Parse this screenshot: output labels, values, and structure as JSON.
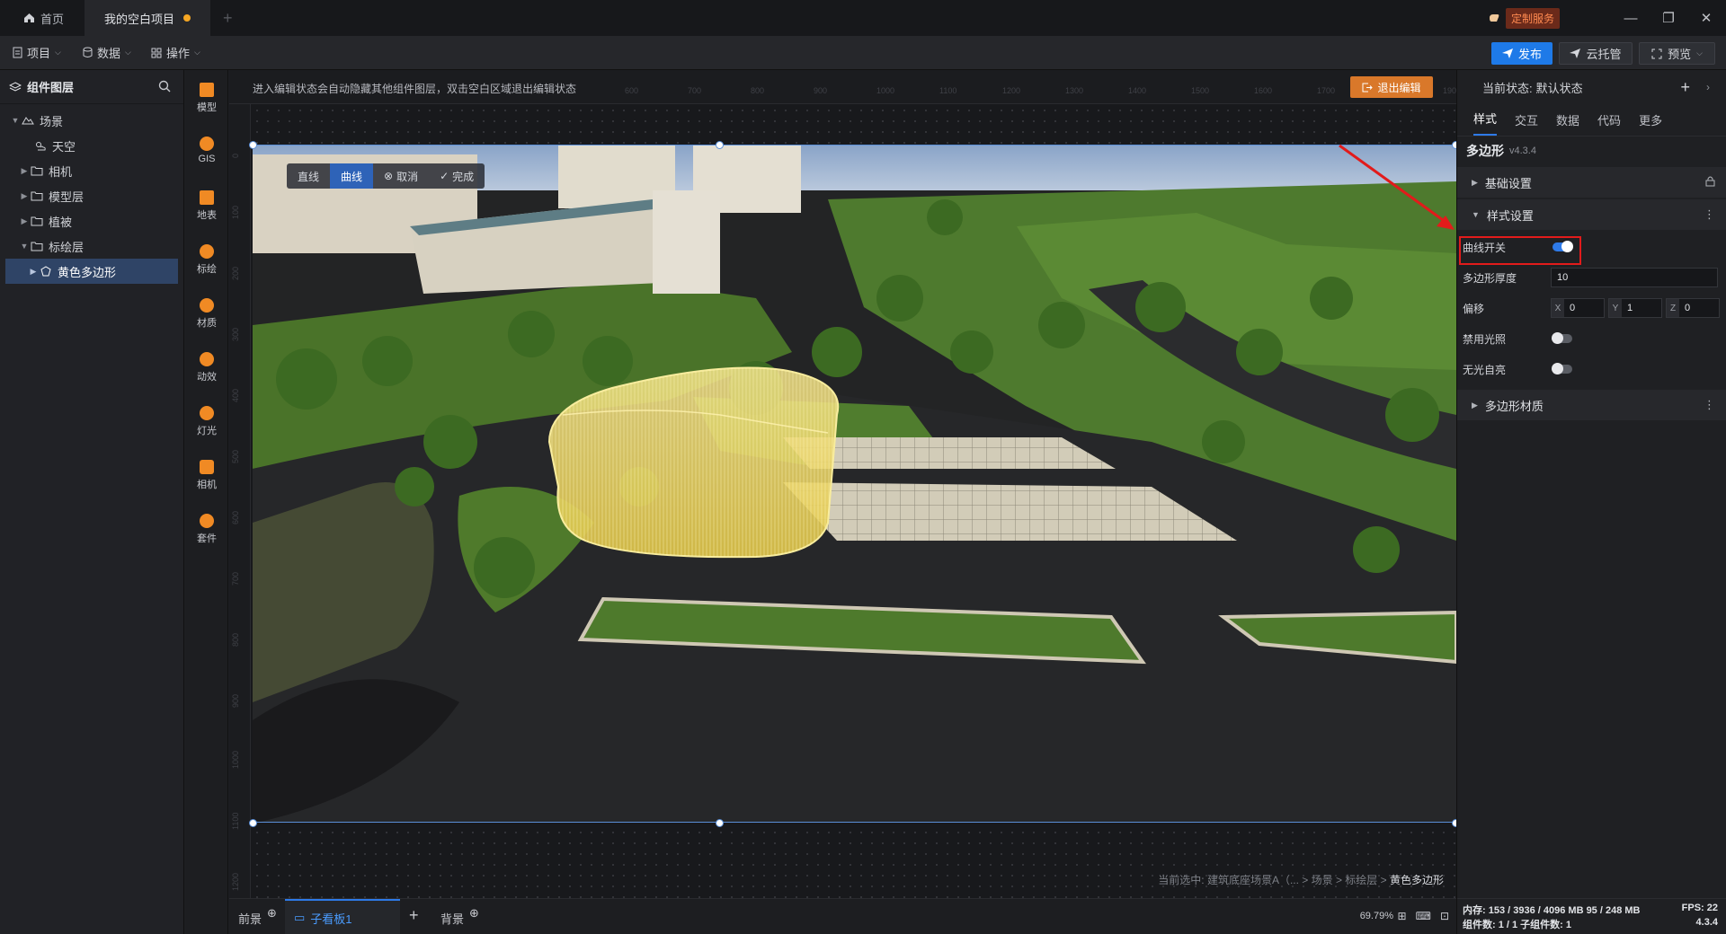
{
  "titlebar": {
    "home_tab": "首页",
    "project_tab": "我的空白项目",
    "custom_service": "定制服务"
  },
  "toolbar": {
    "menus": [
      "项目",
      "数据",
      "操作"
    ],
    "publish": "发布",
    "cloud": "云托管",
    "preview": "预览"
  },
  "layers": {
    "title": "组件图层",
    "items": [
      {
        "label": "场景",
        "level": 0,
        "expanded": true
      },
      {
        "label": "天空",
        "level": 1
      },
      {
        "label": "相机",
        "level": 1
      },
      {
        "label": "模型层",
        "level": 1
      },
      {
        "label": "植被",
        "level": 1
      },
      {
        "label": "标绘层",
        "level": 1,
        "expanded": true
      },
      {
        "label": "黄色多边形",
        "level": 2,
        "selected": true
      }
    ]
  },
  "rail": [
    "模型",
    "GIS",
    "地表",
    "标绘",
    "材质",
    "动效",
    "灯光",
    "相机",
    "套件"
  ],
  "canvas": {
    "hint": "进入编辑状态会自动隐藏其他组件图层，双击空白区域退出编辑状态",
    "exit_edit": "退出编辑",
    "ruler_top": [
      "600",
      "700",
      "800",
      "900",
      "1000",
      "1100",
      "1200",
      "1300",
      "1400",
      "1500",
      "1600",
      "1700",
      "1800",
      "1900"
    ],
    "ruler_left": [
      "0",
      "100",
      "200",
      "300",
      "400",
      "500",
      "600",
      "700",
      "800",
      "900",
      "1000",
      "1100",
      "1200"
    ],
    "draw_tools": [
      "直线",
      "曲线",
      "取消",
      "完成"
    ],
    "breadcrumb_prefix": "当前选中: 建筑底座场景A（... > 场景 > 标绘层 > ",
    "breadcrumb_current": "黄色多边形"
  },
  "bottom": {
    "front": "前景",
    "subboard": "子看板1",
    "background": "背景",
    "zoom": "69.79%"
  },
  "rightpanel": {
    "state_label": "当前状态:",
    "state_value": "默认状态",
    "tabs": [
      "样式",
      "交互",
      "数据",
      "代码",
      "更多"
    ],
    "component": "多边形",
    "version": "v4.3.4",
    "section_basic": "基础设置",
    "section_style": "样式设置",
    "curve_switch": "曲线开关",
    "thickness_label": "多边形厚度",
    "thickness_value": "10",
    "offset_label": "偏移",
    "offset": {
      "x": "0",
      "y": "1",
      "z": "0"
    },
    "disable_light": "禁用光照",
    "no_light_glow": "无光自亮",
    "section_material": "多边形材质",
    "status_mem": "内存: 153 / 3936 / 4096 MB  95 / 248 MB",
    "status_fps": "FPS: 22",
    "status_comp": "组件数: 1 / 1   子组件数: 1",
    "status_ver": "4.3.4"
  },
  "colors": {
    "accent": "#2e7ae8",
    "highlight": "#e21b1b",
    "exit_button": "#d9782a",
    "polygon": "#f2e07a"
  },
  "toggles": {
    "curve_switch": true,
    "disable_light": false,
    "no_light_glow": false
  }
}
